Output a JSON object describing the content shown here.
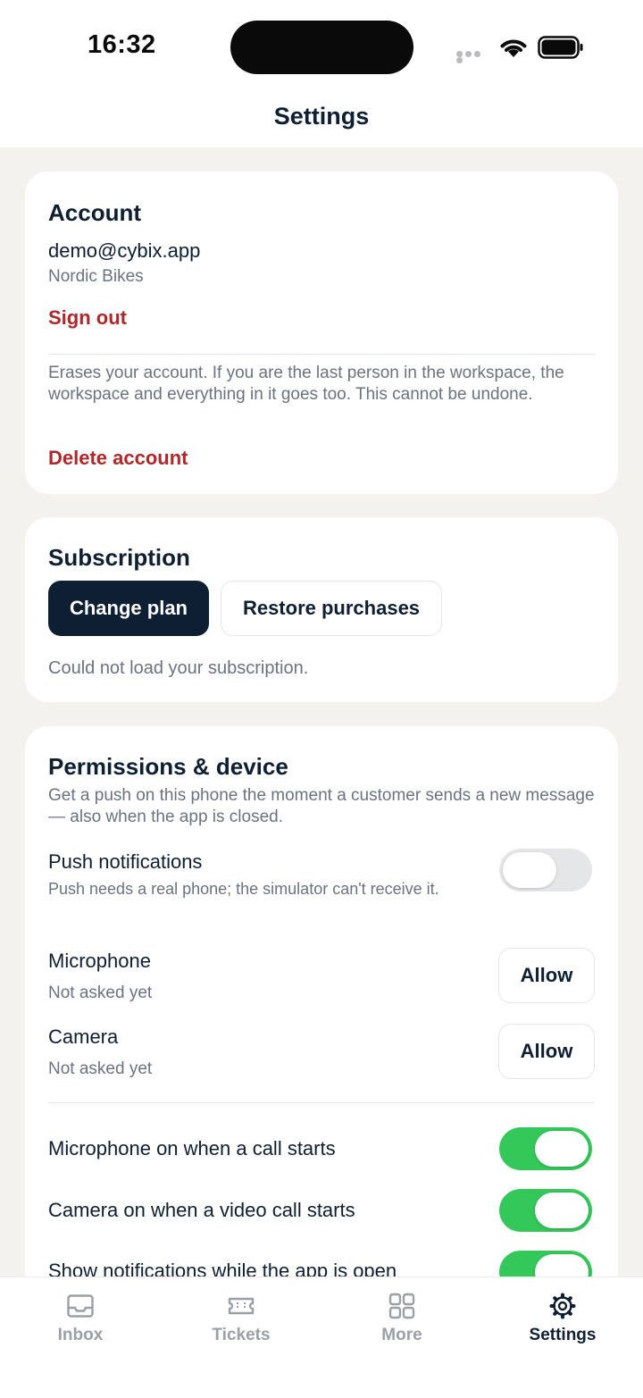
{
  "status_bar": {
    "time": "16:32"
  },
  "header": {
    "title": "Settings"
  },
  "account": {
    "title": "Account",
    "email": "demo@cybix.app",
    "workspace": "Nordic Bikes",
    "sign_out_label": "Sign out",
    "delete_description": "Erases your account. If you are the last person in the workspace, the workspace and everything in it goes too. This cannot be undone.",
    "delete_label": "Delete account"
  },
  "subscription": {
    "title": "Subscription",
    "change_plan_label": "Change plan",
    "restore_label": "Restore purchases",
    "status_text": "Could not load your subscription."
  },
  "permissions": {
    "title": "Permissions & device",
    "description": "Get a push on this phone the moment a customer sends a new message — also when the app is closed.",
    "push": {
      "label": "Push notifications",
      "note": "Push needs a real phone; the simulator can't receive it.",
      "enabled": false
    },
    "microphone": {
      "label": "Microphone",
      "status": "Not asked yet",
      "button": "Allow"
    },
    "camera": {
      "label": "Camera",
      "status": "Not asked yet",
      "button": "Allow"
    },
    "toggles": [
      {
        "label": "Microphone on when a call starts",
        "enabled": true
      },
      {
        "label": "Camera on when a video call starts",
        "enabled": true
      },
      {
        "label": "Show notifications while the app is open",
        "enabled": true
      }
    ]
  },
  "tabbar": {
    "items": [
      {
        "label": "Inbox",
        "icon": "inbox-icon",
        "active": false
      },
      {
        "label": "Tickets",
        "icon": "ticket-icon",
        "active": false
      },
      {
        "label": "More",
        "icon": "grid-icon",
        "active": false
      },
      {
        "label": "Settings",
        "icon": "gear-icon",
        "active": true
      }
    ]
  },
  "colors": {
    "brand_dark": "#0f1f33",
    "danger": "#b0272a",
    "toggle_on": "#34c759",
    "background": "#f3f2ef"
  }
}
